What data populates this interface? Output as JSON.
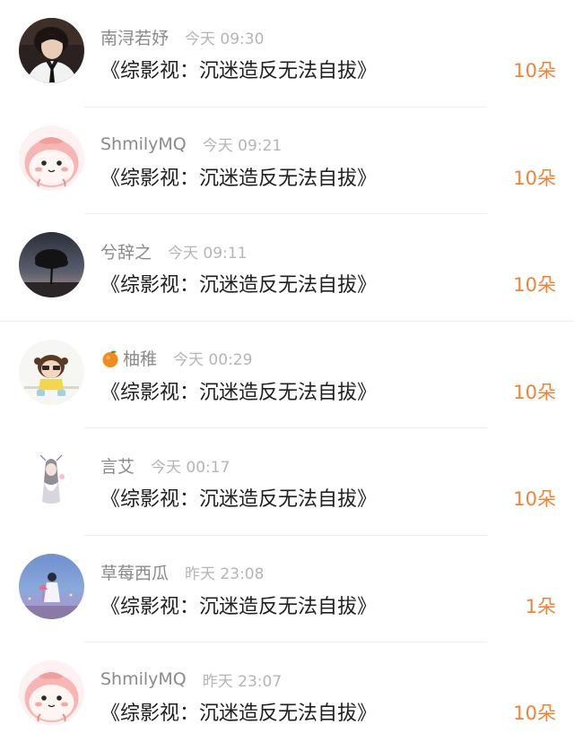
{
  "comments": [
    {
      "avatar": "young-man-suit-avatar",
      "username": "南浔若妤",
      "time": "今天 09:30",
      "title": "《综影视：沉迷造反无法自拔》",
      "count": "10朵"
    },
    {
      "avatar": "pink-blob-cartoon-avatar",
      "username": "ShmilyMQ",
      "time": "今天 09:21",
      "title": "《综影视：沉迷造反无法自拔》",
      "count": "10朵"
    },
    {
      "avatar": "tree-sunset-avatar",
      "username": "兮辞之",
      "time": "今天 09:11",
      "title": "《综影视：沉迷造反无法自拔》",
      "count": "10朵"
    },
    {
      "avatar": "cartoon-kid-avatar",
      "badge": "orange-fruit-icon",
      "username": "柚稚",
      "time": "今天 00:29",
      "title": "《综影视：沉迷造反无法自拔》",
      "count": "10朵"
    },
    {
      "avatar": "ink-sketch-avatar",
      "username": "言艾",
      "time": "今天 00:17",
      "title": "《综影视：沉迷造反无法自拔》",
      "count": "10朵"
    },
    {
      "avatar": "girl-umbrella-avatar",
      "username": "草莓西瓜",
      "time": "昨天 23:08",
      "title": "《综影视：沉迷造反无法自拔》",
      "count": "1朵"
    },
    {
      "avatar": "pink-blob-cartoon-avatar",
      "username": "ShmilyMQ",
      "time": "昨天 23:07",
      "title": "《综影视：沉迷造反无法自拔》",
      "count": "10朵"
    }
  ],
  "colors": {
    "count_accent": "#ec8436",
    "username": "#8a8a8a",
    "timestamp": "#b5b5b5"
  }
}
